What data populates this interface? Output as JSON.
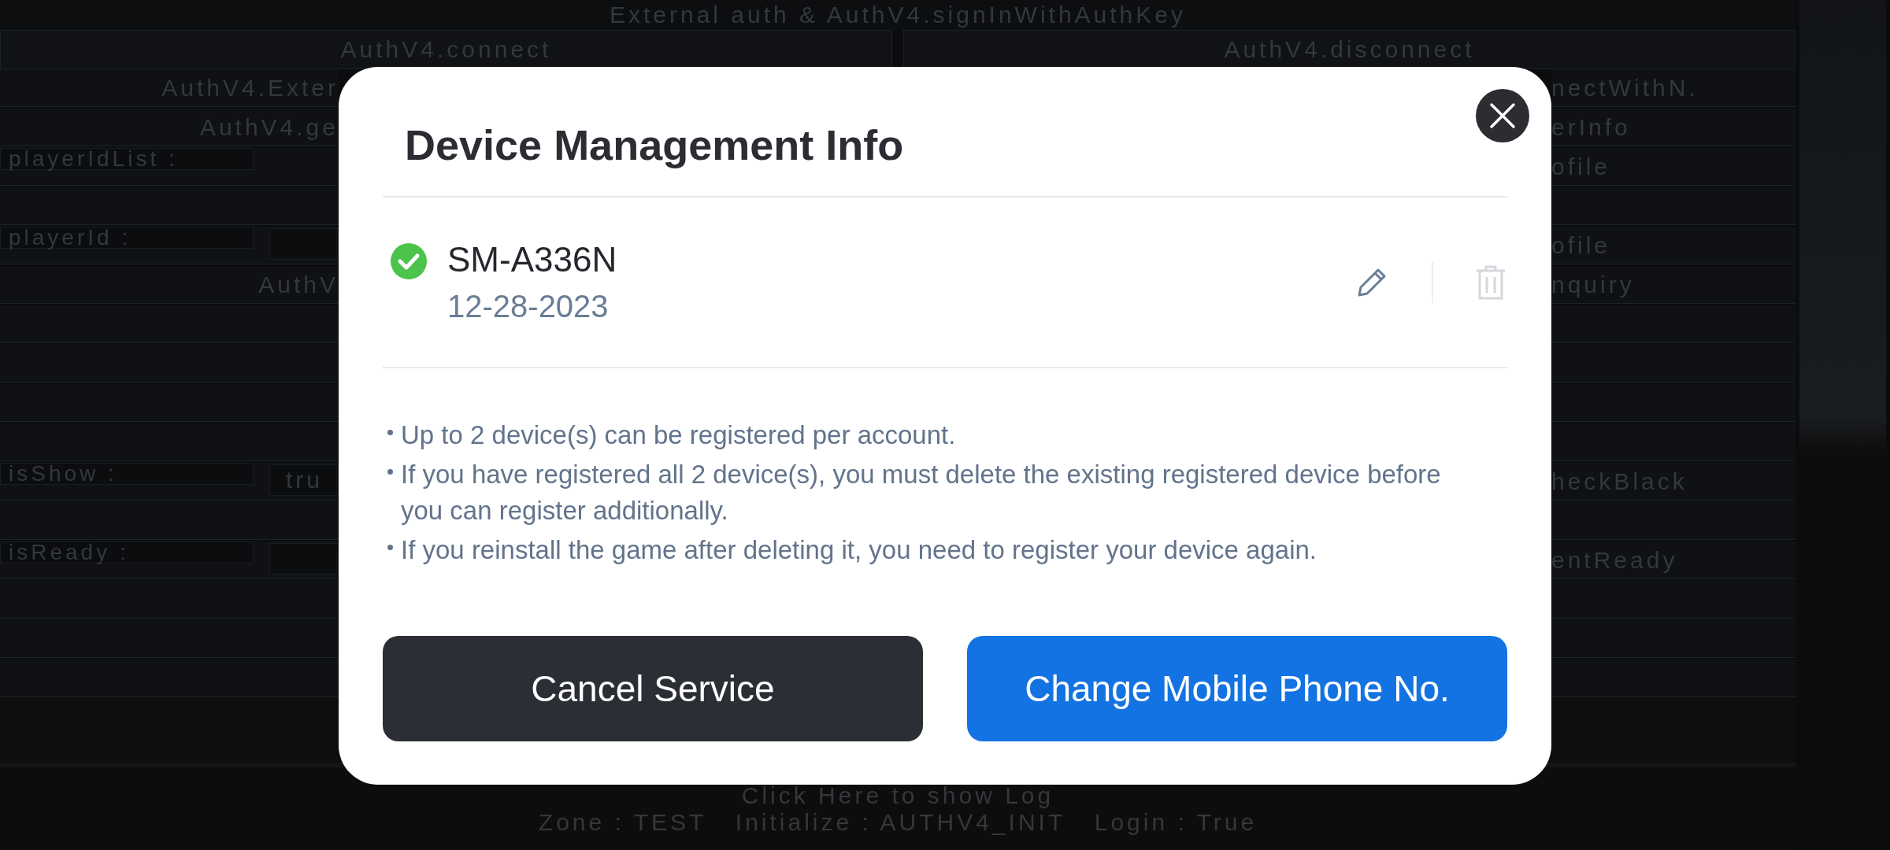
{
  "background": {
    "header": "External auth & AuthV4.signInWithAuthKey",
    "top_buttons": [
      "AuthV4.connect",
      "AuthV4.disconnect"
    ],
    "rows": [
      {
        "kind": "button",
        "left": "AuthV4.Exter",
        "right": "nectWithN."
      },
      {
        "kind": "button",
        "left": "AuthV4.ge",
        "right": "erInfo"
      },
      {
        "kind": "label",
        "left": "playerIdList :",
        "right": "ofile"
      },
      {
        "kind": "button"
      },
      {
        "kind": "field",
        "left": "playerId :",
        "right": "ofile"
      },
      {
        "kind": "button",
        "left": "AuthV",
        "right": "nquiry"
      },
      {
        "kind": "button"
      },
      {
        "kind": "button"
      },
      {
        "kind": "button"
      },
      {
        "kind": "button"
      },
      {
        "kind": "field",
        "left": "isShow :",
        "value": "tru",
        "right": "heckBlack"
      },
      {
        "kind": "button"
      },
      {
        "kind": "field",
        "left": "isReady :",
        "right": "entReady"
      },
      {
        "kind": "button"
      },
      {
        "kind": "button"
      },
      {
        "kind": "button"
      }
    ],
    "status": {
      "log_button": "Click Here to show Log",
      "info": "Zone : TEST   Initialize : AUTHV4_INIT   Login : True"
    }
  },
  "dialog": {
    "title": "Device Management Info",
    "devices": [
      {
        "name": "SM-A336N",
        "date": "12-28-2023",
        "verified": true,
        "delete_disabled": true
      }
    ],
    "notes": [
      "Up to 2 device(s) can be registered per account.",
      "If you have registered all 2 device(s), you must delete the existing registered device before you can register additionally.",
      "If you reinstall the game after deleting it, you need to register your device again."
    ],
    "buttons": [
      {
        "label": "Cancel Service",
        "kind": "secondary"
      },
      {
        "label": "Change Mobile Phone No.",
        "kind": "primary"
      }
    ]
  }
}
